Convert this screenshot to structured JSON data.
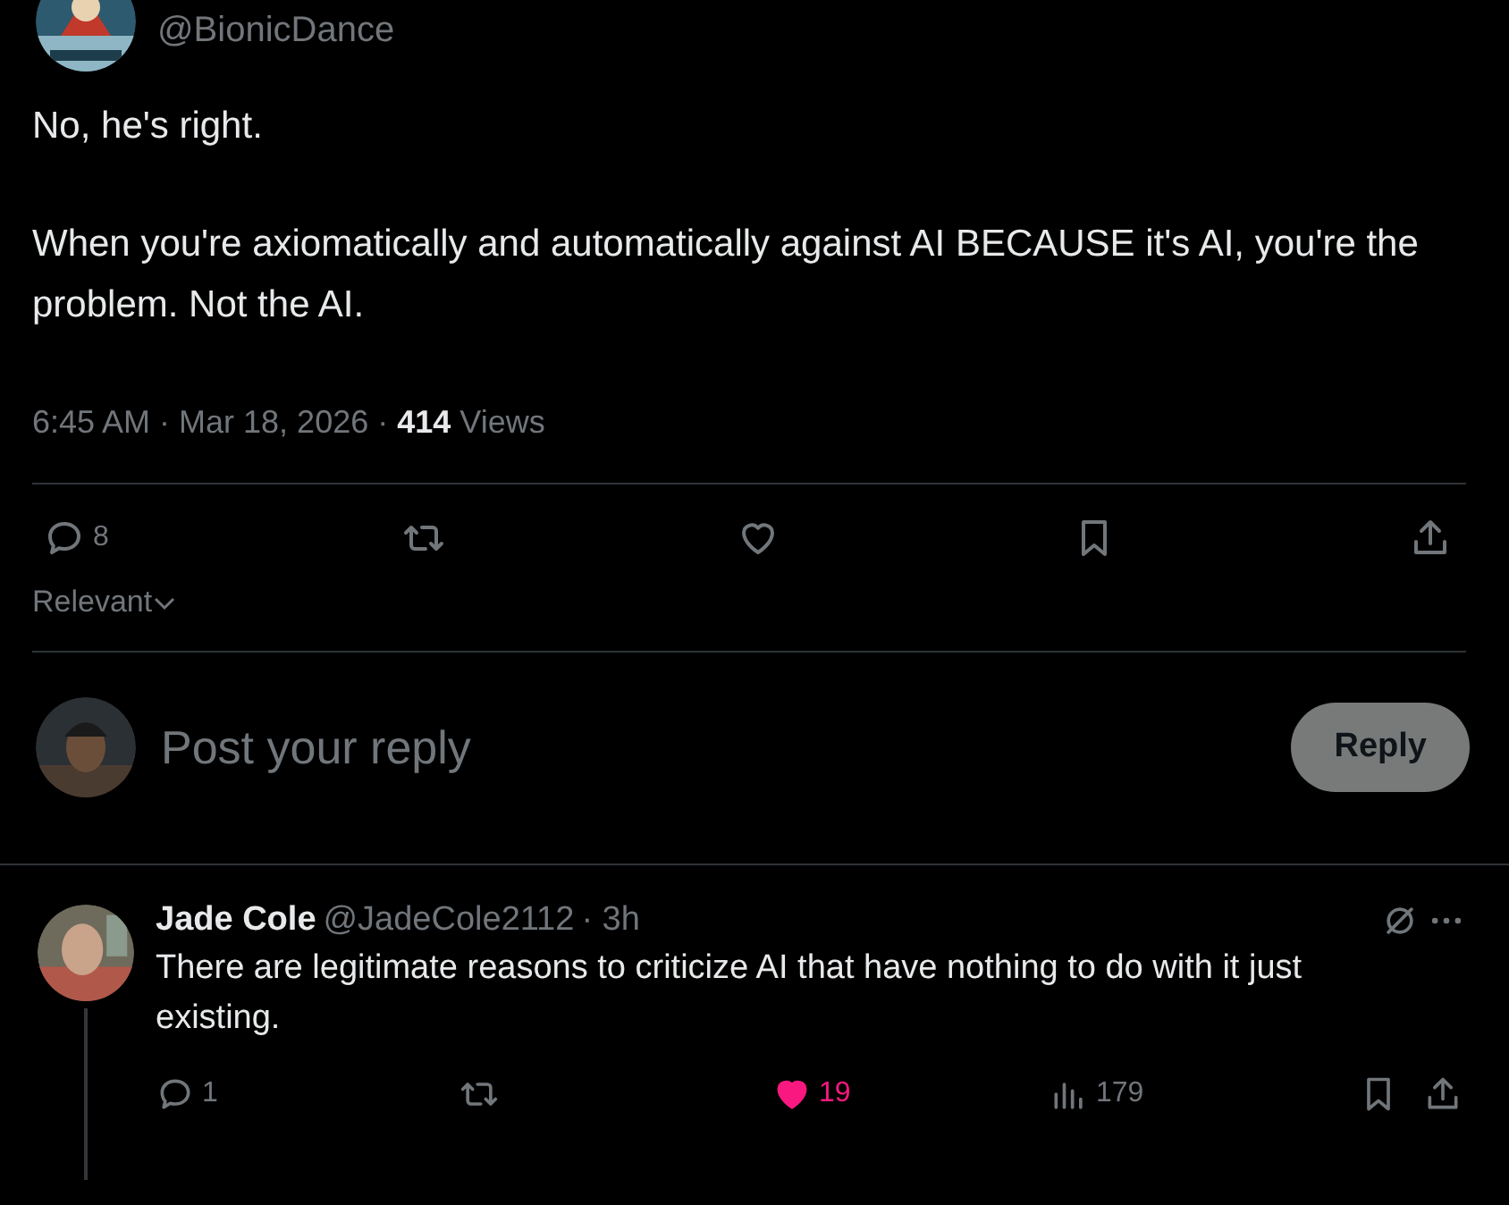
{
  "post": {
    "handle": "@BionicDance",
    "paragraphs": [
      "No, he's right.",
      "When you're axiomatically and automatically against AI BECAUSE it's AI, you're the problem. Not the AI."
    ],
    "time": "6:45 AM · Mar 18, 2026 · ",
    "views_count": "414",
    "views_label": " Views",
    "actions": [
      {
        "kind": "reply",
        "count": "8"
      },
      {
        "kind": "repost"
      },
      {
        "kind": "like"
      },
      {
        "kind": "bookmark"
      },
      {
        "kind": "share"
      }
    ],
    "sort": "Relevant"
  },
  "compose": {
    "placeholder": "Post your reply",
    "button": "Reply"
  },
  "replies": [
    {
      "name": "Jade Cole",
      "handle": "@JadeCole2112",
      "time": " · 3h",
      "text": "There are legitimate reasons to criticize AI that have nothing to do with it just existing.",
      "actions": [
        {
          "kind": "reply",
          "count": "1",
          "selected": false
        },
        {
          "kind": "repost",
          "selected": false
        },
        {
          "kind": "like",
          "count": "19",
          "selected": true
        },
        {
          "kind": "views",
          "count": "179",
          "selected": false
        },
        {
          "kind": "bookmark",
          "selected": false
        },
        {
          "kind": "share",
          "selected": false
        }
      ]
    }
  ]
}
